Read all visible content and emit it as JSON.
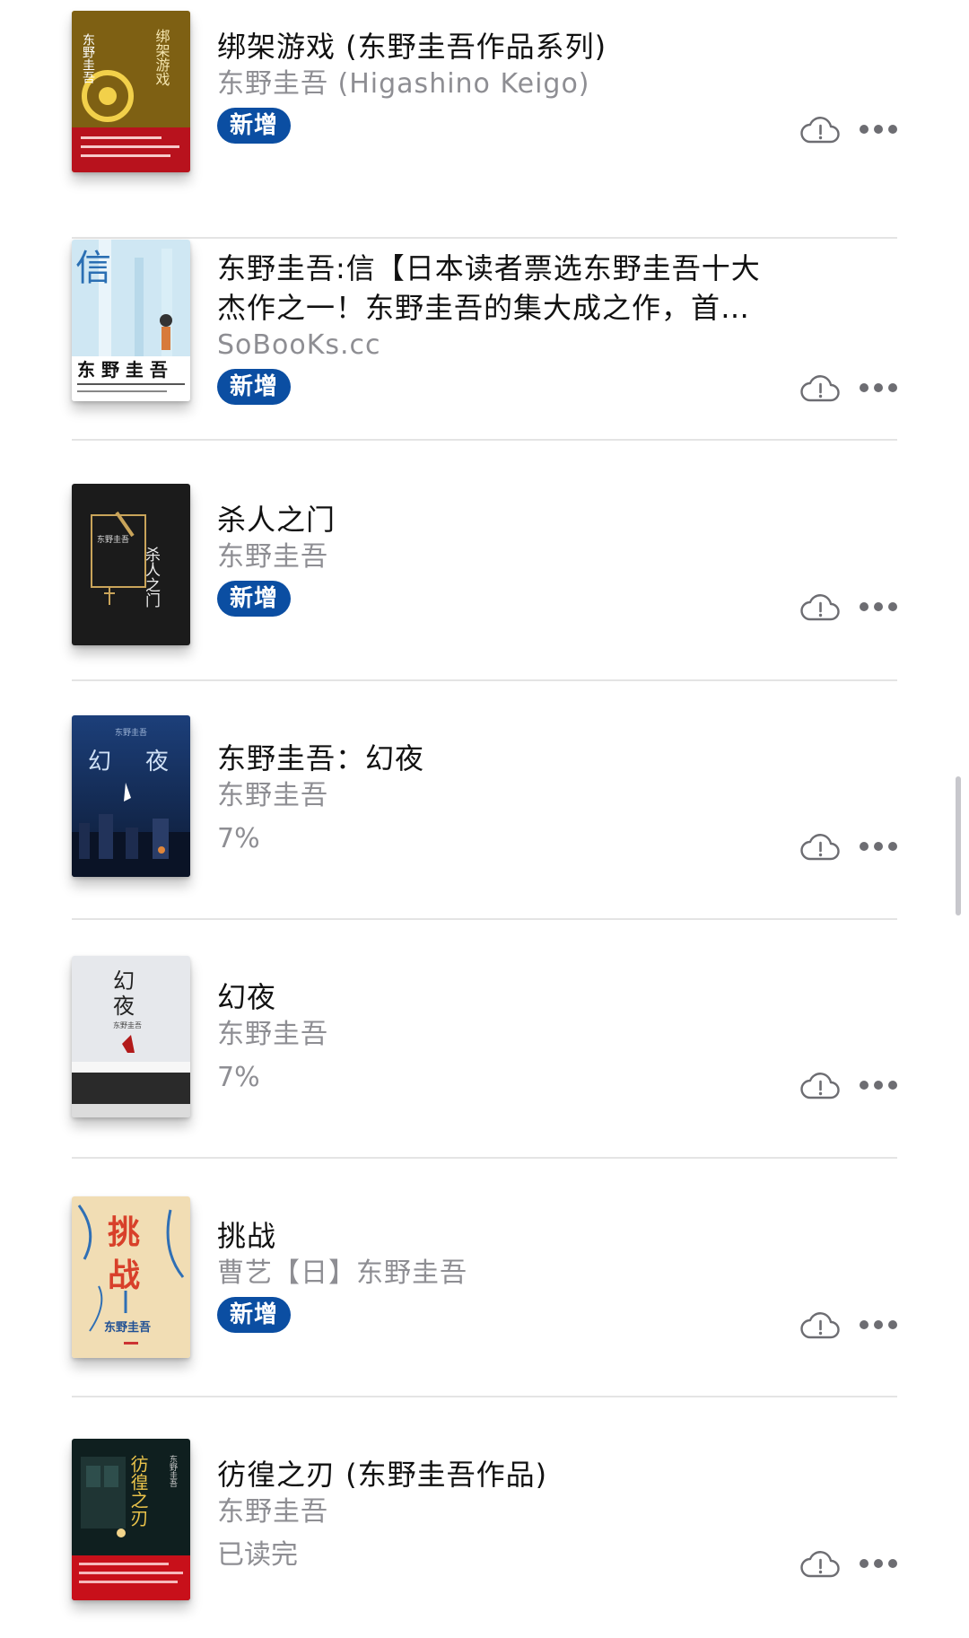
{
  "books": [
    {
      "title": "绑架游戏 (东野圭吾作品系列)",
      "author": "东野圭吾 (Higashino Keigo)",
      "status_type": "badge",
      "status": "新增",
      "cover_text": [
        "东野圭吾",
        "绑架游戏"
      ],
      "cover_colors": [
        "#e3b51f",
        "#b8121d"
      ]
    },
    {
      "title": "东野圭吾:信【日本读者票选东野圭吾十大杰作之一！东野圭吾的集大成之作，首部关注犯罪者家…",
      "author": "SoBooKs.cc",
      "status_type": "badge",
      "status": "新增",
      "cover_text": [
        "信",
        "东 野 圭 吾"
      ],
      "cover_colors": [
        "#cfe7f3",
        "#ffffff"
      ]
    },
    {
      "title": "杀人之门",
      "author": "东野圭吾",
      "status_type": "badge",
      "status": "新增",
      "cover_text": [
        "东野圭吾",
        "杀人之门"
      ],
      "cover_colors": [
        "#1b1b1b",
        "#c9a45a"
      ]
    },
    {
      "title": "东野圭吾：幻夜",
      "author": "东野圭吾",
      "status_type": "text",
      "status": "7%",
      "cover_text": [
        "东野圭吾",
        "幻",
        "夜"
      ],
      "cover_colors": [
        "#1c3f7a",
        "#0d1a33"
      ]
    },
    {
      "title": "幻夜",
      "author": "东野圭吾",
      "status_type": "text",
      "status": "7%",
      "cover_text": [
        "幻",
        "夜",
        "东野圭吾"
      ],
      "cover_colors": [
        "#e6e8ec",
        "#2a2a2a"
      ]
    },
    {
      "title": "挑战",
      "author": "曹艺【日】东野圭吾",
      "status_type": "badge",
      "status": "新增",
      "cover_text": [
        "挑",
        "战",
        "东野圭吾"
      ],
      "cover_colors": [
        "#f1ddb4",
        "#d8402a"
      ]
    },
    {
      "title": "彷徨之刃 (东野圭吾作品)",
      "author": "东野圭吾",
      "status_type": "text",
      "status": "已读完",
      "cover_text": [
        "彷徨之刃",
        "东野圭吾"
      ],
      "cover_colors": [
        "#0f1f1f",
        "#c8101a"
      ]
    }
  ],
  "icons": {
    "cloud": "cloud-alert-icon",
    "more": "more-ellipsis-icon"
  },
  "colors": {
    "badge": "#0b4ea2",
    "secondary_text": "#8e8e93"
  }
}
